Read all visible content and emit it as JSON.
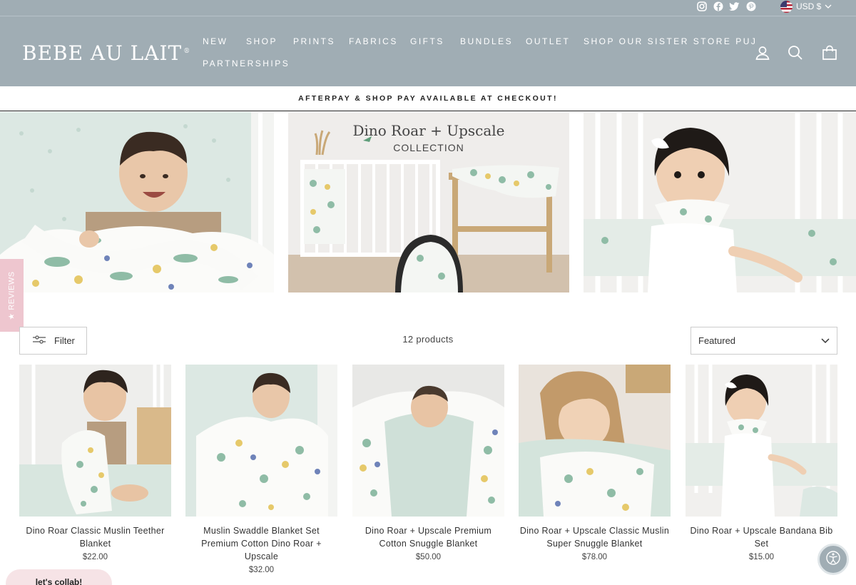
{
  "header": {
    "logo_text": "BEBE AU LAIT",
    "logo_mark": "®",
    "currency": "USD $",
    "nav": [
      "NEW",
      "SHOP",
      "PRINTS",
      "FABRICS",
      "GIFTS",
      "BUNDLES",
      "OUTLET",
      "SHOP OUR SISTER STORE PUJ",
      "PARTNERSHIPS"
    ],
    "icons": [
      "instagram-icon",
      "facebook-icon",
      "twitter-icon",
      "pinterest-icon",
      "user-icon",
      "search-icon",
      "cart-icon"
    ]
  },
  "announcement": "AFTERPAY & SHOP PAY AVAILABLE AT CHECKOUT!",
  "hero": {
    "title": "Dino Roar + Upscale",
    "subtitle": "COLLECTION"
  },
  "reviews_tab": "★ REVIEWS",
  "toolbar": {
    "filter_label": "Filter",
    "count": "12 products",
    "sort_value": "Featured"
  },
  "products": [
    {
      "title": "Dino Roar Classic Muslin Teether Blanket",
      "price": "$22.00"
    },
    {
      "title": "Muslin Swaddle Blanket Set Premium Cotton Dino Roar + Upscale",
      "price": "$32.00"
    },
    {
      "title": "Dino Roar + Upscale Premium Cotton Snuggle Blanket",
      "price": "$50.00"
    },
    {
      "title": "Dino Roar + Upscale Classic Muslin Super Snuggle Blanket",
      "price": "$78.00"
    },
    {
      "title": "Dino Roar + Upscale Bandana Bib Set",
      "price": "$15.00"
    }
  ],
  "collab_label": "let's collab!",
  "colors": {
    "header_bg": "#a0adb4",
    "reviews_pink": "#eec6cf",
    "collab_pink": "#f6e3e6"
  }
}
